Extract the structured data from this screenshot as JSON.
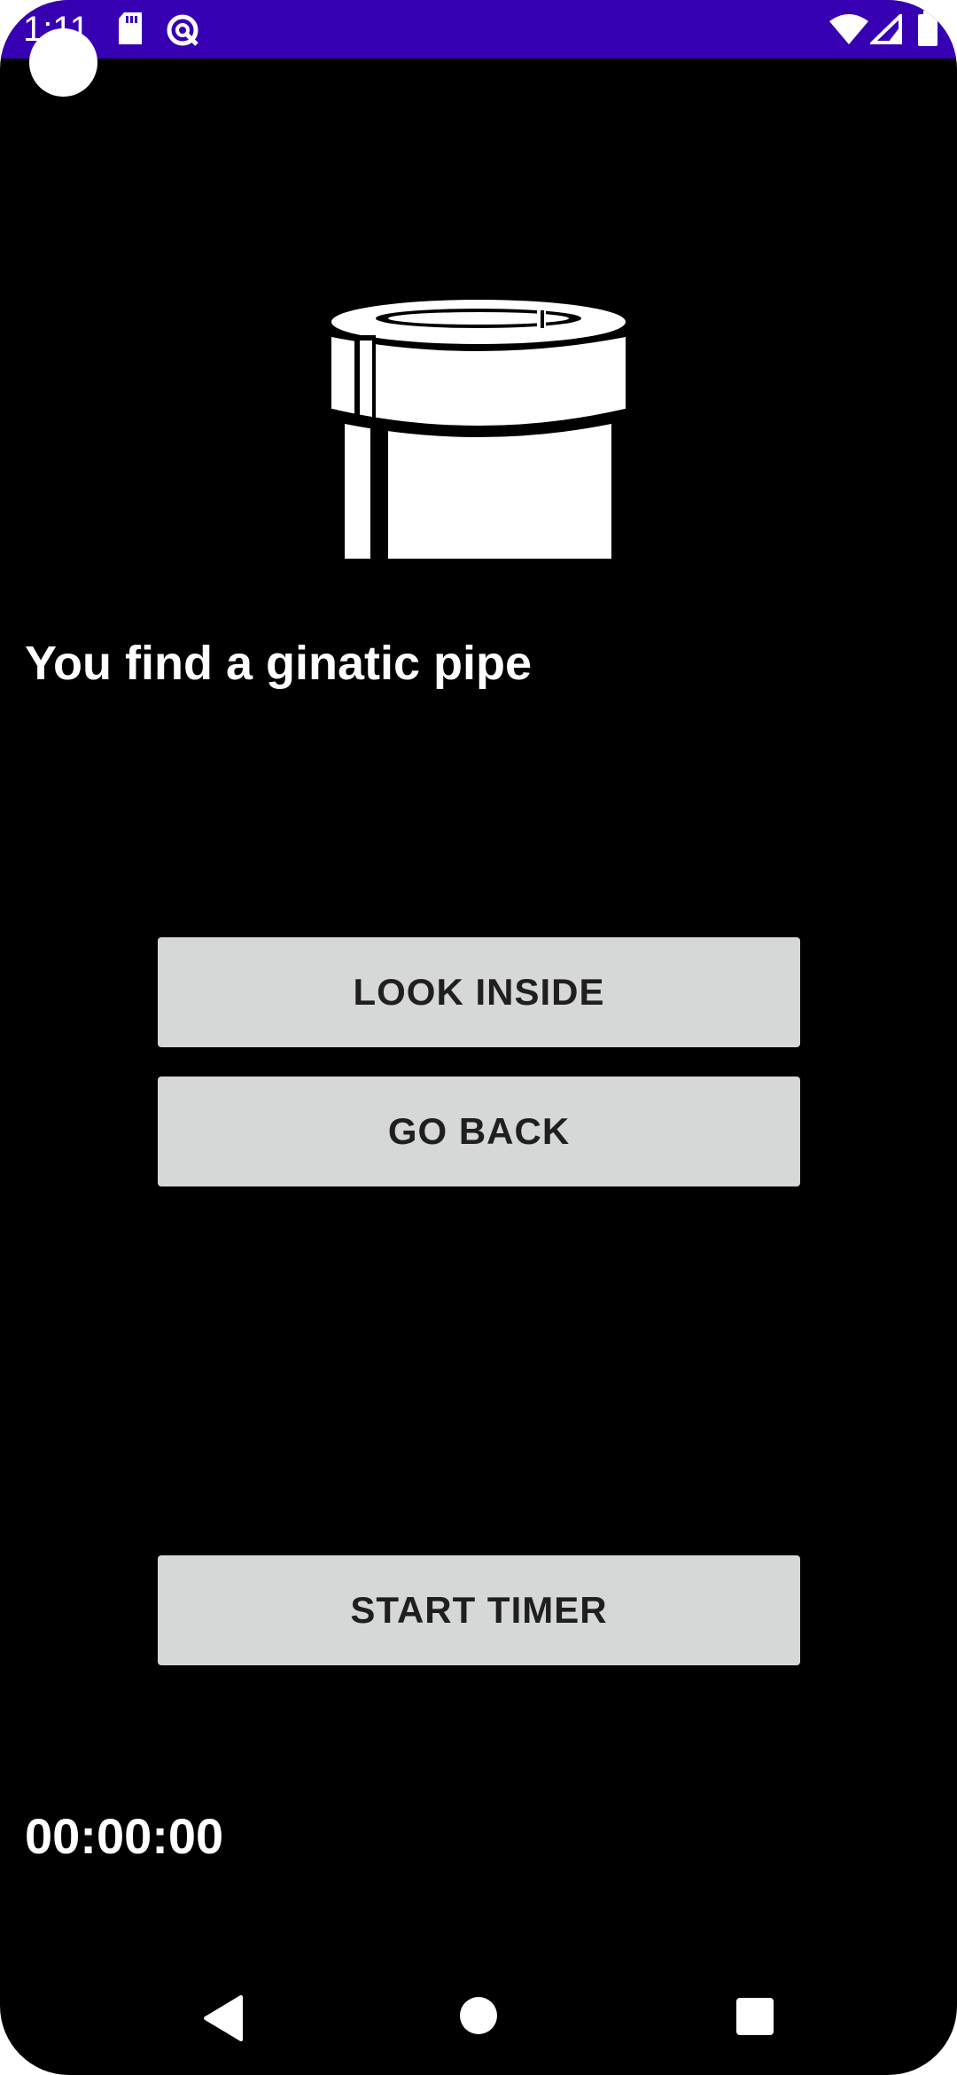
{
  "status_bar": {
    "time": "1:11",
    "background_color": "#3700b3",
    "icons": [
      "sd-card-icon",
      "data-saver-icon",
      "wifi-icon",
      "cell-signal-icon",
      "battery-icon"
    ]
  },
  "scene": {
    "image_icon": "pipe-icon",
    "message": "You find a ginatic pipe"
  },
  "buttons": {
    "look_inside": "LOOK INSIDE",
    "go_back": "GO BACK",
    "start_timer": "START TIMER"
  },
  "timer": {
    "value": "00:00:00"
  },
  "navigation": {
    "icons": [
      "back-icon",
      "home-icon",
      "recents-icon"
    ]
  },
  "colors": {
    "background": "#000000",
    "button_bg": "#d6d7d7",
    "button_text": "#1f1f1f",
    "text": "#ffffff"
  }
}
